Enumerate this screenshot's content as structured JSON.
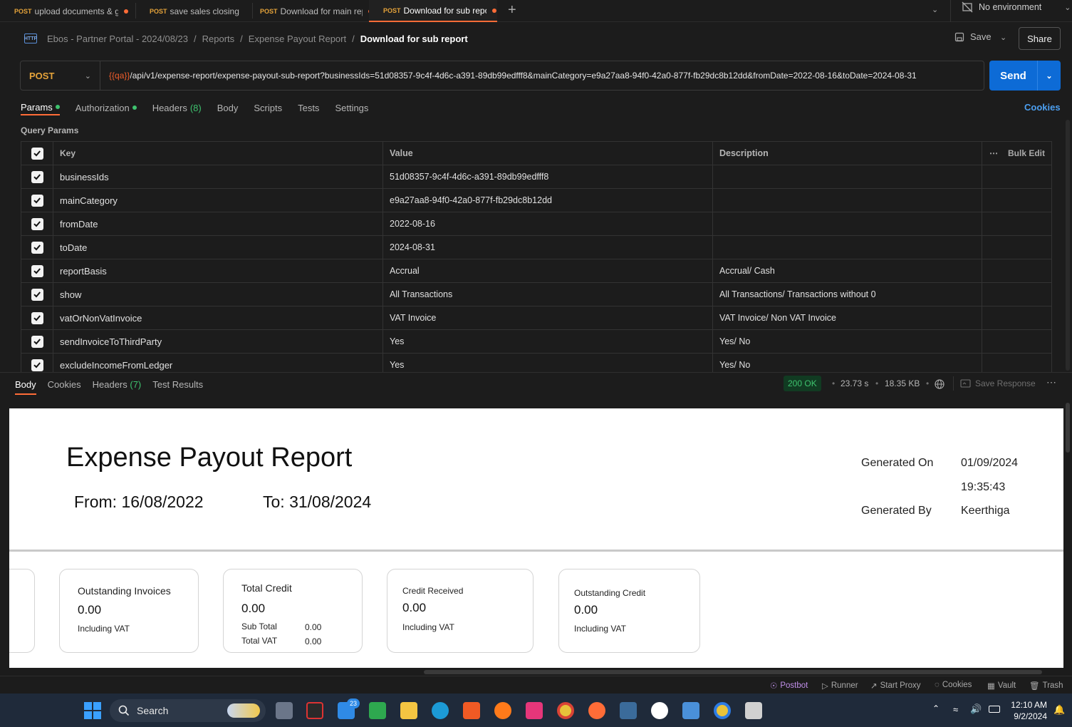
{
  "tabs": [
    {
      "method": "POST",
      "name": "upload documents & g",
      "dirty": true,
      "active": false
    },
    {
      "method": "POST",
      "name": "save sales closing",
      "dirty": false,
      "active": false
    },
    {
      "method": "POST",
      "name": "Download for main rep",
      "dirty": true,
      "active": false
    },
    {
      "method": "POST",
      "name": "Download for sub repo",
      "dirty": true,
      "active": true
    }
  ],
  "environment": "No environment",
  "breadcrumb": {
    "items": [
      "Ebos - Partner Portal - 2024/08/23",
      "Reports",
      "Expense Payout Report"
    ],
    "current": "Download for sub report"
  },
  "header": {
    "save_label": "Save",
    "share_label": "Share"
  },
  "request": {
    "method": "POST",
    "url_var": "{{qa}}",
    "url_rest": "/api/v1/expense-report/expense-payout-sub-report?businessIds=51d08357-9c4f-4d6c-a391-89db99edfff8&mainCategory=e9a27aa8-94f0-42a0-877f-fb29dc8b12dd&fromDate=2022-08-16&toDate=2024-08-31",
    "send_label": "Send"
  },
  "request_tabs": {
    "params": "Params",
    "authorization": "Authorization",
    "headers": "Headers",
    "headers_count": "(8)",
    "body": "Body",
    "scripts": "Scripts",
    "tests": "Tests",
    "settings": "Settings",
    "cookies": "Cookies"
  },
  "query_params": {
    "title": "Query Params",
    "headers": {
      "key": "Key",
      "value": "Value",
      "description": "Description",
      "bulk_edit": "Bulk Edit"
    },
    "rows": [
      {
        "key": "businessIds",
        "value": "51d08357-9c4f-4d6c-a391-89db99edfff8",
        "description": ""
      },
      {
        "key": "mainCategory",
        "value": "e9a27aa8-94f0-42a0-877f-fb29dc8b12dd",
        "description": ""
      },
      {
        "key": "fromDate",
        "value": "2022-08-16",
        "description": ""
      },
      {
        "key": "toDate",
        "value": "2024-08-31",
        "description": ""
      },
      {
        "key": "reportBasis",
        "value": "Accrual",
        "description": "Accrual/ Cash"
      },
      {
        "key": "show",
        "value": "All Transactions",
        "description": "All Transactions/ Transactions without 0"
      },
      {
        "key": "vatOrNonVatInvoice",
        "value": "VAT Invoice",
        "description": "VAT Invoice/ Non VAT Invoice"
      },
      {
        "key": "sendInvoiceToThirdParty",
        "value": "Yes",
        "description": "Yes/ No"
      },
      {
        "key": "excludeIncomeFromLedger",
        "value": "Yes",
        "description": "Yes/ No"
      }
    ]
  },
  "response": {
    "tabs": {
      "body": "Body",
      "cookies": "Cookies",
      "headers": "Headers",
      "headers_count": "(7)",
      "test_results": "Test Results"
    },
    "status": "200 OK",
    "time": "23.73 s",
    "size": "18.35 KB",
    "save_response": "Save Response"
  },
  "report": {
    "title": "Expense Payout Report",
    "from": "From: 16/08/2022",
    "to": "To: 31/08/2024",
    "generated_on_label": "Generated On",
    "generated_on_date": "01/09/2024",
    "generated_on_time": "19:35:43",
    "generated_by_label": "Generated By",
    "generated_by": "Keerthiga",
    "cards": {
      "outstanding_invoices": {
        "title": "Outstanding Invoices",
        "value": "0.00",
        "note": "Including VAT"
      },
      "total_credit": {
        "title": "Total Credit",
        "value": "0.00",
        "sub_total_label": "Sub Total",
        "sub_total": "0.00",
        "total_vat_label": "Total VAT",
        "total_vat": "0.00"
      },
      "credit_received": {
        "title": "Credit Received",
        "value": "0.00",
        "note": "Including VAT"
      },
      "outstanding_credit": {
        "title": "Outstanding Credit",
        "value": "0.00",
        "note": "Including VAT"
      }
    }
  },
  "footer": {
    "postbot": "Postbot",
    "runner": "Runner",
    "start_proxy": "Start Proxy",
    "cookies": "Cookies",
    "vault": "Vault",
    "trash": "Trash"
  },
  "taskbar": {
    "search_placeholder": "Search",
    "mail_badge": "23",
    "time": "12:10 AM",
    "date": "9/2/2024"
  },
  "colors": {
    "accent": "#ff6c37",
    "send": "#0d6bd6",
    "method": "#e5a33a",
    "success": "#3ec26e",
    "link": "#4c9ff0"
  }
}
